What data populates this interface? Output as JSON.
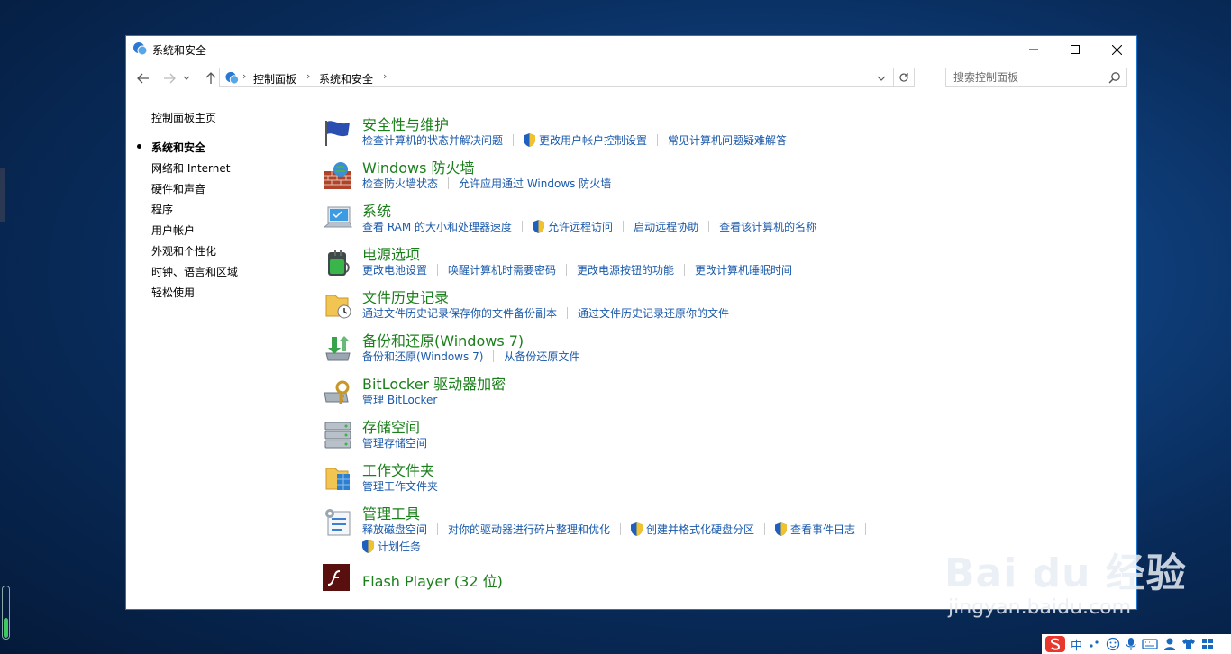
{
  "window": {
    "title": "系统和安全",
    "icon": "control-panel-icon",
    "controls": [
      "minimize-icon",
      "maximize-icon",
      "close-icon"
    ]
  },
  "nav": {
    "back": "back-arrow-icon",
    "forward": "forward-arrow-icon",
    "recent": "chevron-down-icon",
    "up": "up-arrow-icon"
  },
  "address": {
    "crumbs": [
      "控制面板",
      "系统和安全"
    ]
  },
  "search": {
    "placeholder": "搜索控制面板"
  },
  "sidebar": {
    "home": "控制面板主页",
    "items": [
      {
        "label": "系统和安全",
        "active": true
      },
      {
        "label": "网络和 Internet"
      },
      {
        "label": "硬件和声音"
      },
      {
        "label": "程序"
      },
      {
        "label": "用户帐户"
      },
      {
        "label": "外观和个性化"
      },
      {
        "label": "时钟、语言和区域"
      },
      {
        "label": "轻松使用"
      }
    ]
  },
  "categories": [
    {
      "title": "安全性与维护",
      "icon": "security-flag-icon",
      "links": [
        {
          "text": "检查计算机的状态并解决问题"
        },
        {
          "text": "更改用户帐户控制设置",
          "shield": true
        },
        {
          "text": "常见计算机问题疑难解答"
        }
      ]
    },
    {
      "title": "Windows 防火墙",
      "icon": "firewall-icon",
      "links": [
        {
          "text": "检查防火墙状态"
        },
        {
          "text": "允许应用通过 Windows 防火墙"
        }
      ]
    },
    {
      "title": "系统",
      "icon": "system-computer-icon",
      "links": [
        {
          "text": "查看 RAM 的大小和处理器速度"
        },
        {
          "text": "允许远程访问",
          "shield": true
        },
        {
          "text": "启动远程协助"
        },
        {
          "text": "查看该计算机的名称"
        }
      ]
    },
    {
      "title": "电源选项",
      "icon": "power-options-icon",
      "links": [
        {
          "text": "更改电池设置"
        },
        {
          "text": "唤醒计算机时需要密码"
        },
        {
          "text": "更改电源按钮的功能"
        },
        {
          "text": "更改计算机睡眠时间"
        }
      ]
    },
    {
      "title": "文件历史记录",
      "icon": "file-history-icon",
      "links": [
        {
          "text": "通过文件历史记录保存你的文件备份副本"
        },
        {
          "text": "通过文件历史记录还原你的文件"
        }
      ]
    },
    {
      "title": "备份和还原(Windows 7)",
      "icon": "backup-restore-icon",
      "links": [
        {
          "text": "备份和还原(Windows 7)"
        },
        {
          "text": "从备份还原文件"
        }
      ]
    },
    {
      "title": "BitLocker 驱动器加密",
      "icon": "bitlocker-icon",
      "links": [
        {
          "text": "管理 BitLocker"
        }
      ]
    },
    {
      "title": "存储空间",
      "icon": "storage-spaces-icon",
      "links": [
        {
          "text": "管理存储空间"
        }
      ]
    },
    {
      "title": "工作文件夹",
      "icon": "work-folders-icon",
      "links": [
        {
          "text": "管理工作文件夹"
        }
      ]
    },
    {
      "title": "管理工具",
      "icon": "admin-tools-icon",
      "links": [
        {
          "text": "释放磁盘空间"
        },
        {
          "text": "对你的驱动器进行碎片整理和优化"
        },
        {
          "text": "创建并格式化硬盘分区",
          "shield": true
        },
        {
          "text": "查看事件日志",
          "shield": true
        }
      ],
      "links2": [
        {
          "text": "计划任务",
          "shield": true
        }
      ]
    },
    {
      "title": "Flash Player (32 位)",
      "icon": "flash-player-icon",
      "links": []
    }
  ],
  "watermark": {
    "main": "Bai du 经验",
    "sub": "jingyan.baidu.com"
  },
  "tray": {
    "ime": "中"
  },
  "colors": {
    "link": "#1a5aab",
    "category_title": "#1a7f1a",
    "window_border": "#1878d0"
  }
}
